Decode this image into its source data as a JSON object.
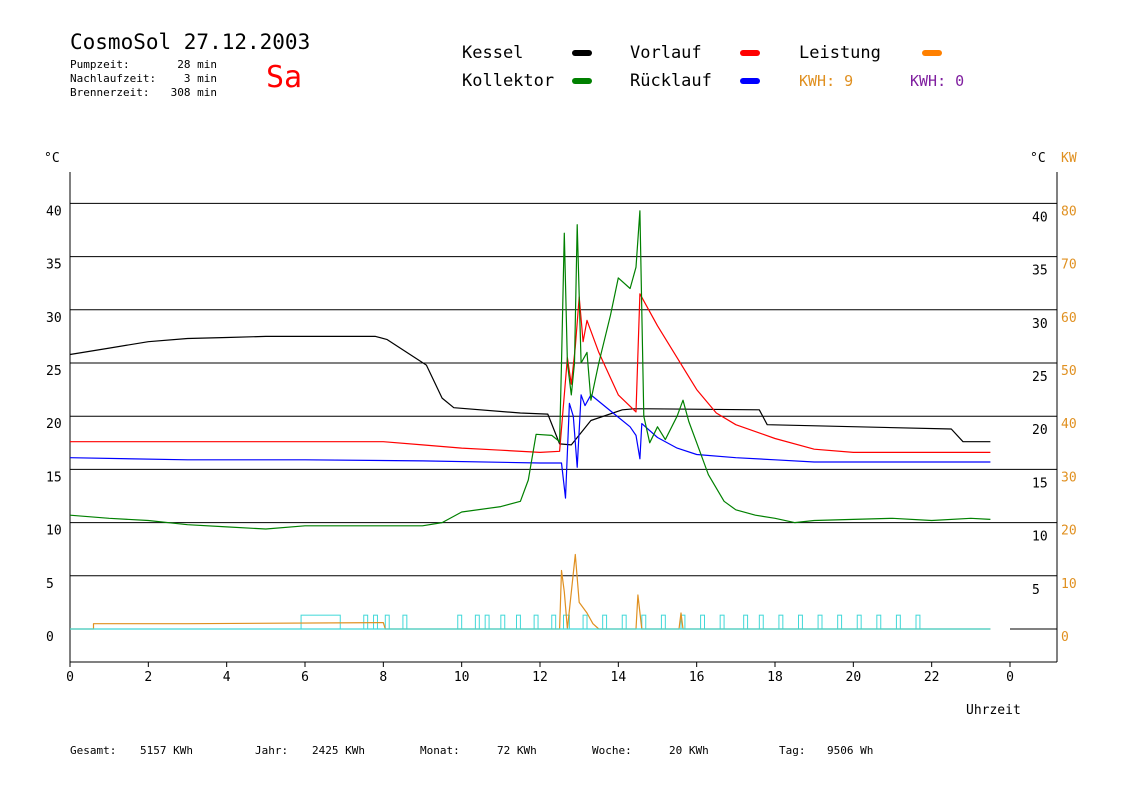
{
  "header": {
    "title": "CosmoSol 27.12.2003",
    "day": "Sa",
    "stats": [
      {
        "label": "Pumpzeit:",
        "value": "28 min"
      },
      {
        "label": "Nachlaufzeit:",
        "value": "3 min"
      },
      {
        "label": "Brennerzeit:",
        "value": "308 min"
      }
    ]
  },
  "legend": {
    "items": [
      {
        "label": "Kessel",
        "color": "#000000"
      },
      {
        "label": "Vorlauf",
        "color": "#ff0000"
      },
      {
        "label": "Leistung",
        "color": "#ff8000"
      },
      {
        "label": "Kollektor",
        "color": "#008000"
      },
      {
        "label": "Rücklauf",
        "color": "#0000ff"
      }
    ],
    "kwh1": "KWH: 9",
    "kwh1_color": "#e09020",
    "kwh2": "KWH: 0",
    "kwh2_color": "#8020a0"
  },
  "chart_data": {
    "type": "line",
    "xlabel": "Uhrzeit",
    "x_ticks": [
      "0",
      "2",
      "4",
      "6",
      "8",
      "10",
      "12",
      "14",
      "16",
      "18",
      "20",
      "22",
      "0"
    ],
    "xlim": [
      0,
      24
    ],
    "left_unit": "°C",
    "right_unit_c": "°C",
    "right_unit_kw": "KW",
    "ylim": [
      0,
      45
    ],
    "y_ticks_left": [
      "0",
      "5",
      "10",
      "15",
      "20",
      "25",
      "30",
      "35",
      "40"
    ],
    "y_ticks_right_c": [
      "5",
      "10",
      "15",
      "20",
      "25",
      "30",
      "35",
      "40"
    ],
    "y_ticks_right_kw": [
      "0",
      "10",
      "20",
      "30",
      "40",
      "50",
      "60",
      "70",
      "80"
    ],
    "grid": true,
    "series": [
      {
        "name": "Kessel",
        "color": "#000000",
        "points": [
          [
            0,
            25.8
          ],
          [
            1,
            26.4
          ],
          [
            2,
            27.0
          ],
          [
            3,
            27.3
          ],
          [
            4,
            27.4
          ],
          [
            5,
            27.5
          ],
          [
            7.8,
            27.5
          ],
          [
            8.1,
            27.2
          ],
          [
            8.6,
            26.0
          ],
          [
            9.1,
            24.8
          ],
          [
            9.5,
            21.7
          ],
          [
            9.8,
            20.8
          ],
          [
            11.5,
            20.3
          ],
          [
            12.2,
            20.2
          ],
          [
            12.5,
            17.4
          ],
          [
            12.8,
            17.3
          ],
          [
            13.3,
            19.6
          ],
          [
            14.1,
            20.6
          ],
          [
            14.4,
            20.7
          ],
          [
            14.8,
            20.7
          ],
          [
            17.6,
            20.6
          ],
          [
            17.8,
            19.2
          ],
          [
            22.5,
            18.8
          ],
          [
            22.8,
            17.6
          ],
          [
            23.5,
            17.6
          ]
        ]
      },
      {
        "name": "Vorlauf",
        "color": "#ff0000",
        "points": [
          [
            0,
            17.6
          ],
          [
            8,
            17.6
          ],
          [
            9,
            17.3
          ],
          [
            10,
            17.0
          ],
          [
            11,
            16.8
          ],
          [
            12,
            16.6
          ],
          [
            12.5,
            16.7
          ],
          [
            12.7,
            25.5
          ],
          [
            12.8,
            23.0
          ],
          [
            12.9,
            26.5
          ],
          [
            13.0,
            31.2
          ],
          [
            13.1,
            27.0
          ],
          [
            13.2,
            29.0
          ],
          [
            13.5,
            26.0
          ],
          [
            14.0,
            22.0
          ],
          [
            14.45,
            20.4
          ],
          [
            14.55,
            31.5
          ],
          [
            15.0,
            28.5
          ],
          [
            15.5,
            25.5
          ],
          [
            16.0,
            22.5
          ],
          [
            16.5,
            20.3
          ],
          [
            17.0,
            19.2
          ],
          [
            18.0,
            17.9
          ],
          [
            19.0,
            16.9
          ],
          [
            20.0,
            16.6
          ],
          [
            23.5,
            16.6
          ]
        ]
      },
      {
        "name": "Rücklauf",
        "color": "#0000ff",
        "points": [
          [
            0,
            16.1
          ],
          [
            3,
            15.9
          ],
          [
            6,
            15.9
          ],
          [
            9,
            15.8
          ],
          [
            12,
            15.6
          ],
          [
            12.55,
            15.6
          ],
          [
            12.65,
            12.3
          ],
          [
            12.75,
            21.2
          ],
          [
            12.85,
            20.0
          ],
          [
            12.95,
            15.2
          ],
          [
            13.05,
            22.0
          ],
          [
            13.15,
            21.0
          ],
          [
            13.3,
            22.0
          ],
          [
            13.8,
            20.5
          ],
          [
            14.3,
            19.0
          ],
          [
            14.45,
            18.2
          ],
          [
            14.55,
            16.0
          ],
          [
            14.6,
            19.3
          ],
          [
            15.0,
            18.0
          ],
          [
            15.5,
            17.0
          ],
          [
            16.0,
            16.4
          ],
          [
            17.0,
            16.1
          ],
          [
            18.0,
            15.9
          ],
          [
            19.0,
            15.7
          ],
          [
            23.5,
            15.7
          ]
        ]
      },
      {
        "name": "Kollektor",
        "color": "#008000",
        "points": [
          [
            0,
            10.7
          ],
          [
            1,
            10.4
          ],
          [
            2,
            10.2
          ],
          [
            3,
            9.8
          ],
          [
            4,
            9.6
          ],
          [
            5,
            9.4
          ],
          [
            6,
            9.7
          ],
          [
            7,
            9.7
          ],
          [
            8,
            9.7
          ],
          [
            9,
            9.7
          ],
          [
            9.5,
            10.0
          ],
          [
            10,
            11.0
          ],
          [
            11,
            11.5
          ],
          [
            11.5,
            12.0
          ],
          [
            11.7,
            14.0
          ],
          [
            11.9,
            18.3
          ],
          [
            12.3,
            18.2
          ],
          [
            12.5,
            17.6
          ],
          [
            12.55,
            25.0
          ],
          [
            12.62,
            37.2
          ],
          [
            12.7,
            25.0
          ],
          [
            12.8,
            22.0
          ],
          [
            12.88,
            25.0
          ],
          [
            12.95,
            38.0
          ],
          [
            13.05,
            25.0
          ],
          [
            13.2,
            26.0
          ],
          [
            13.3,
            21.5
          ],
          [
            13.5,
            25.0
          ],
          [
            13.8,
            29.5
          ],
          [
            14.0,
            33.0
          ],
          [
            14.3,
            32.0
          ],
          [
            14.45,
            34.0
          ],
          [
            14.55,
            39.3
          ],
          [
            14.65,
            20.0
          ],
          [
            14.8,
            17.5
          ],
          [
            15.0,
            19.0
          ],
          [
            15.2,
            17.8
          ],
          [
            15.5,
            20.0
          ],
          [
            15.65,
            21.5
          ],
          [
            15.8,
            19.5
          ],
          [
            16.0,
            17.5
          ],
          [
            16.3,
            14.5
          ],
          [
            16.7,
            12.0
          ],
          [
            17.0,
            11.2
          ],
          [
            17.5,
            10.7
          ],
          [
            18.0,
            10.4
          ],
          [
            18.5,
            10.0
          ],
          [
            19.0,
            10.2
          ],
          [
            20.0,
            10.3
          ],
          [
            21.0,
            10.4
          ],
          [
            22.0,
            10.2
          ],
          [
            23.0,
            10.4
          ],
          [
            23.5,
            10.3
          ]
        ]
      },
      {
        "name": "Leistung",
        "color": "#e09020",
        "points": [
          [
            0,
            0
          ],
          [
            0.6,
            0
          ],
          [
            0.6,
            0.5
          ],
          [
            1.0,
            0.5
          ],
          [
            3.0,
            0.5
          ],
          [
            8.0,
            0.6
          ],
          [
            8.05,
            0
          ],
          [
            12.5,
            0
          ],
          [
            12.55,
            5.5
          ],
          [
            12.62,
            3.5
          ],
          [
            12.7,
            0
          ],
          [
            12.9,
            7.0
          ],
          [
            13.0,
            2.5
          ],
          [
            13.2,
            1.5
          ],
          [
            13.35,
            0.5
          ],
          [
            13.5,
            0
          ],
          [
            14.45,
            0
          ],
          [
            14.5,
            3.2
          ],
          [
            14.6,
            0
          ],
          [
            15.55,
            0
          ],
          [
            15.6,
            1.5
          ],
          [
            15.65,
            0
          ],
          [
            23.5,
            0
          ]
        ]
      },
      {
        "name": "Pumpe",
        "color": "#40d8d8",
        "points": [
          [
            0,
            0
          ],
          [
            23.5,
            0
          ]
        ]
      }
    ]
  },
  "footer": [
    {
      "label": "Gesamt:",
      "value": "5157 KWh"
    },
    {
      "label": "Jahr:",
      "value": "2425 KWh"
    },
    {
      "label": "Monat:",
      "value": "72 KWh"
    },
    {
      "label": "Woche:",
      "value": "20 KWh"
    },
    {
      "label": "Tag:",
      "value": "9506 Wh"
    }
  ]
}
